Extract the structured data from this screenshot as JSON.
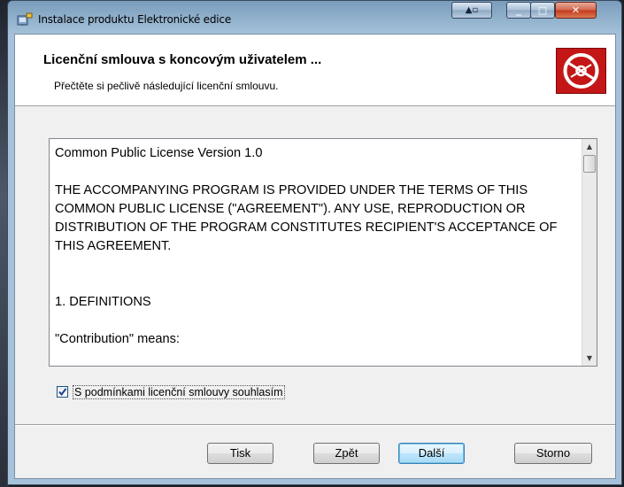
{
  "window": {
    "title": "Instalace produktu Elektronické edice"
  },
  "banner": {
    "title": "Licenční smlouva s koncovým uživatelem ...",
    "subtitle": "Přečtěte si pečlivě následující licenční smlouvu."
  },
  "license": {
    "lines": [
      "Common Public License Version 1.0",
      "",
      "THE ACCOMPANYING PROGRAM IS PROVIDED UNDER THE TERMS OF THIS COMMON PUBLIC LICENSE (\"AGREEMENT\"). ANY USE, REPRODUCTION OR DISTRIBUTION OF THE PROGRAM CONSTITUTES RECIPIENT'S ACCEPTANCE OF THIS AGREEMENT.",
      "",
      "",
      "1. DEFINITIONS",
      "",
      "\"Contribution\" means:"
    ]
  },
  "agree": {
    "checked": true,
    "label": "S podmínkami licenční smlouvy souhlasím"
  },
  "buttons": {
    "print": "Tisk",
    "back": "Zpět",
    "next": "Další",
    "cancel": "Storno"
  },
  "colors": {
    "logo_bg": "#c41616",
    "next_button": "#bee6fd",
    "close_button": "#c5391b"
  },
  "icons": {
    "app": "installer-icon",
    "logo": "disc-icon"
  }
}
